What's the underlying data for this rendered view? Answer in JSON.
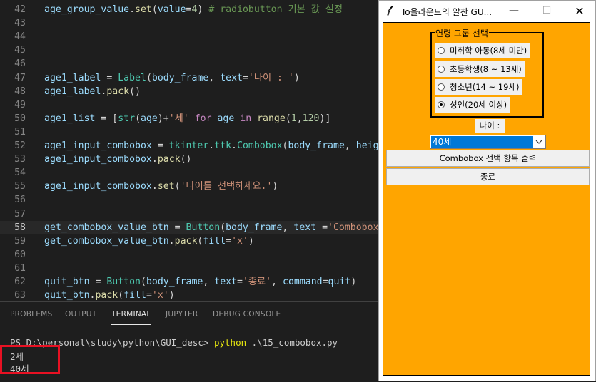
{
  "editor": {
    "lines": [
      {
        "n": "42",
        "segs": [
          [
            "t-var",
            "age_group_value"
          ],
          [
            "t-p",
            "."
          ],
          [
            "t-fn",
            "set"
          ],
          [
            "t-p",
            "("
          ],
          [
            "t-var",
            "value"
          ],
          [
            "t-p",
            "="
          ],
          [
            "t-num",
            "4"
          ],
          [
            "t-p",
            ") "
          ],
          [
            "t-cm",
            "# radiobutton 기본 값 설정"
          ]
        ]
      },
      {
        "n": "43",
        "segs": []
      },
      {
        "n": "44",
        "segs": []
      },
      {
        "n": "45",
        "segs": []
      },
      {
        "n": "46",
        "segs": []
      },
      {
        "n": "47",
        "segs": [
          [
            "t-var",
            "age1_label"
          ],
          [
            "t-p",
            " = "
          ],
          [
            "t-cls",
            "Label"
          ],
          [
            "t-p",
            "("
          ],
          [
            "t-var",
            "body_frame"
          ],
          [
            "t-p",
            ", "
          ],
          [
            "t-var",
            "text"
          ],
          [
            "t-p",
            "="
          ],
          [
            "t-str",
            "'나이 : '"
          ],
          [
            "t-p",
            ")"
          ]
        ]
      },
      {
        "n": "48",
        "segs": [
          [
            "t-var",
            "age1_label"
          ],
          [
            "t-p",
            "."
          ],
          [
            "t-fn",
            "pack"
          ],
          [
            "t-p",
            "()"
          ]
        ]
      },
      {
        "n": "49",
        "segs": []
      },
      {
        "n": "50",
        "segs": [
          [
            "t-var",
            "age1_list"
          ],
          [
            "t-p",
            " = ["
          ],
          [
            "t-blt",
            "str"
          ],
          [
            "t-p",
            "("
          ],
          [
            "t-var",
            "age"
          ],
          [
            "t-p",
            ")+"
          ],
          [
            "t-str",
            "'세'"
          ],
          [
            "t-p",
            " "
          ],
          [
            "t-kw",
            "for"
          ],
          [
            "t-p",
            " "
          ],
          [
            "t-var",
            "age"
          ],
          [
            "t-p",
            " "
          ],
          [
            "t-kw",
            "in"
          ],
          [
            "t-p",
            " "
          ],
          [
            "t-fn",
            "range"
          ],
          [
            "t-p",
            "("
          ],
          [
            "t-num",
            "1"
          ],
          [
            "t-p",
            ","
          ],
          [
            "t-num",
            "120"
          ],
          [
            "t-p",
            ")]"
          ]
        ]
      },
      {
        "n": "51",
        "segs": []
      },
      {
        "n": "52",
        "segs": [
          [
            "t-var",
            "age1_input_combobox"
          ],
          [
            "t-p",
            " = "
          ],
          [
            "t-cls",
            "tkinter"
          ],
          [
            "t-p",
            "."
          ],
          [
            "t-cls",
            "ttk"
          ],
          [
            "t-p",
            "."
          ],
          [
            "t-cls",
            "Combobox"
          ],
          [
            "t-p",
            "("
          ],
          [
            "t-var",
            "body_frame"
          ],
          [
            "t-p",
            ", "
          ],
          [
            "t-var",
            "height"
          ]
        ]
      },
      {
        "n": "53",
        "segs": [
          [
            "t-var",
            "age1_input_combobox"
          ],
          [
            "t-p",
            "."
          ],
          [
            "t-fn",
            "pack"
          ],
          [
            "t-p",
            "()"
          ]
        ]
      },
      {
        "n": "54",
        "segs": []
      },
      {
        "n": "55",
        "segs": [
          [
            "t-var",
            "age1_input_combobox"
          ],
          [
            "t-p",
            "."
          ],
          [
            "t-fn",
            "set"
          ],
          [
            "t-p",
            "("
          ],
          [
            "t-str",
            "'나이를 선택하세요.'"
          ],
          [
            "t-p",
            ")"
          ]
        ]
      },
      {
        "n": "56",
        "segs": []
      },
      {
        "n": "57",
        "segs": []
      },
      {
        "n": "58",
        "segs": [
          [
            "t-var",
            "get_combobox_value_btn"
          ],
          [
            "t-p",
            " = "
          ],
          [
            "t-cls",
            "Button"
          ],
          [
            "t-p",
            "("
          ],
          [
            "t-var",
            "body_frame"
          ],
          [
            "t-p",
            ", "
          ],
          [
            "t-var",
            "text"
          ],
          [
            "t-p",
            " ="
          ],
          [
            "t-str",
            "'Combobox 선"
          ]
        ]
      },
      {
        "n": "59",
        "segs": [
          [
            "t-var",
            "get_combobox_value_btn"
          ],
          [
            "t-p",
            "."
          ],
          [
            "t-fn",
            "pack"
          ],
          [
            "t-p",
            "("
          ],
          [
            "t-var",
            "fill"
          ],
          [
            "t-p",
            "="
          ],
          [
            "t-str",
            "'x'"
          ],
          [
            "t-p",
            ")"
          ]
        ]
      },
      {
        "n": "60",
        "segs": []
      },
      {
        "n": "61",
        "segs": []
      },
      {
        "n": "62",
        "segs": [
          [
            "t-var",
            "quit_btn"
          ],
          [
            "t-p",
            " = "
          ],
          [
            "t-cls",
            "Button"
          ],
          [
            "t-p",
            "("
          ],
          [
            "t-var",
            "body_frame"
          ],
          [
            "t-p",
            ", "
          ],
          [
            "t-var",
            "text"
          ],
          [
            "t-p",
            "="
          ],
          [
            "t-str",
            "'종료'"
          ],
          [
            "t-p",
            ", "
          ],
          [
            "t-var",
            "command"
          ],
          [
            "t-p",
            "="
          ],
          [
            "t-var",
            "quit"
          ],
          [
            "t-p",
            ")"
          ]
        ]
      },
      {
        "n": "63",
        "segs": [
          [
            "t-var",
            "quit_btn"
          ],
          [
            "t-p",
            "."
          ],
          [
            "t-fn",
            "pack"
          ],
          [
            "t-p",
            "("
          ],
          [
            "t-var",
            "fill"
          ],
          [
            "t-p",
            "="
          ],
          [
            "t-str",
            "'x'"
          ],
          [
            "t-p",
            ")"
          ]
        ]
      }
    ]
  },
  "panel": {
    "tabs": [
      "PROBLEMS",
      "OUTPUT",
      "TERMINAL",
      "JUPYTER",
      "DEBUG CONSOLE"
    ],
    "active_tab": "TERMINAL",
    "terminal": {
      "prompt": "PS D:\\personal\\study\\python\\GUI_desc> ",
      "command": "python",
      "args": " .\\15_combobox.py",
      "output": [
        "2세",
        "40세"
      ]
    }
  },
  "tk_window": {
    "title": "To올라운드의 알찬 GU...",
    "min_glyph": "—",
    "max_glyph": "☐",
    "close_glyph": "✕",
    "group_label": "연령 그룹 선택",
    "radios": [
      {
        "label": "미취학 아동(8세 미만)",
        "checked": false
      },
      {
        "label": "초등학생(8 ~ 13세)",
        "checked": false
      },
      {
        "label": "청소년(14 ~ 19세)",
        "checked": false
      },
      {
        "label": "성인(20세 이상)",
        "checked": true
      }
    ],
    "age_label": "나이 :",
    "combobox_value": "40세",
    "print_button": "Combobox 선택 항목 출력",
    "quit_button": "종료"
  },
  "colors": {
    "body_frame": "#ffa500",
    "highlight_box": "#e81123",
    "selection": "#0078d7"
  }
}
